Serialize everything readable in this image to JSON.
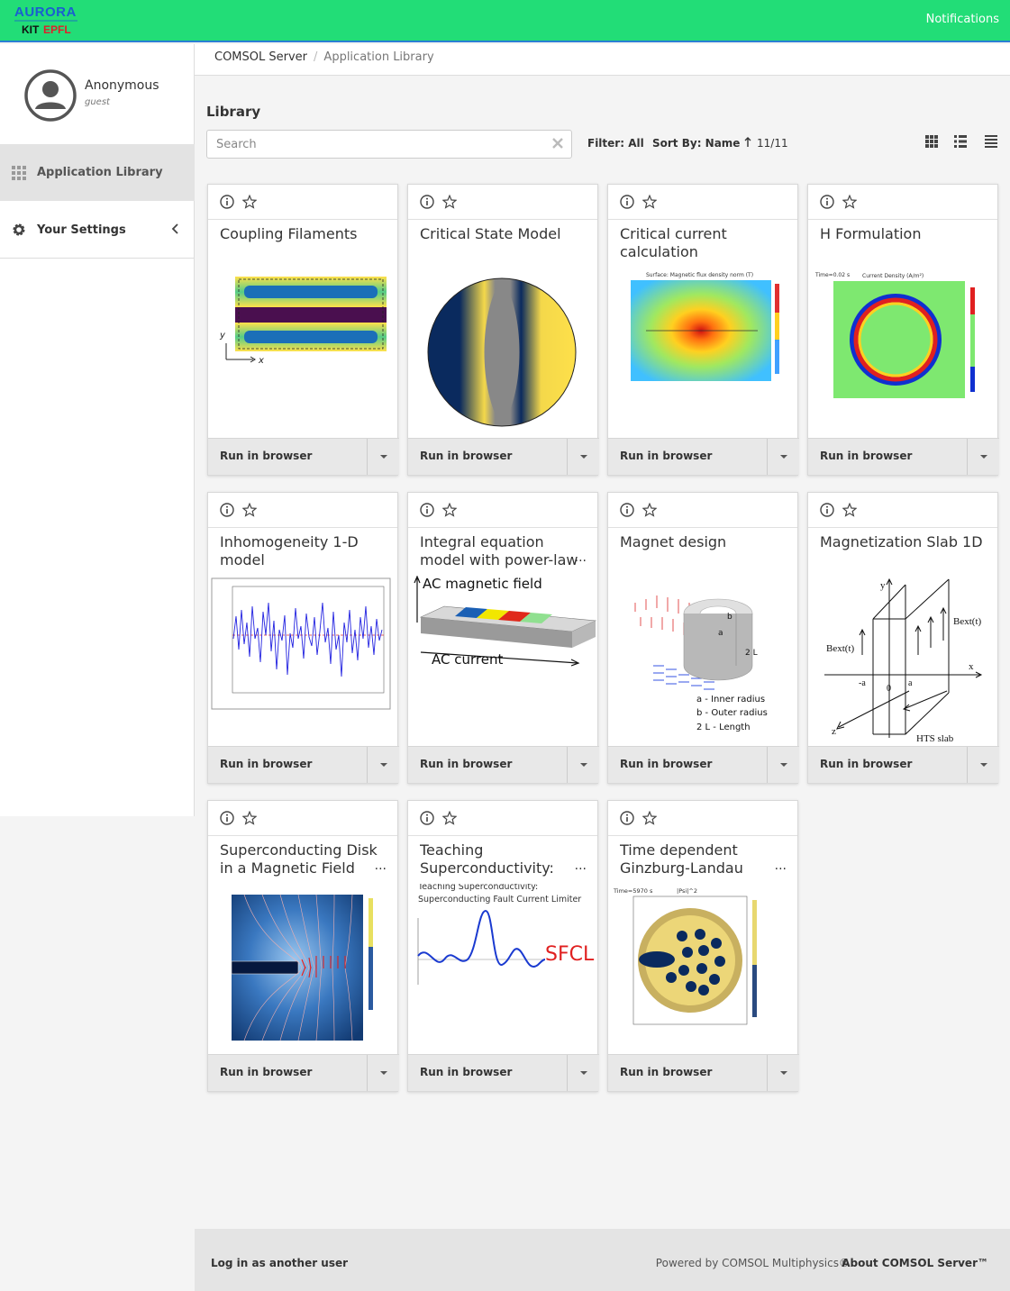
{
  "topbar": {
    "logo_top": "AURORA",
    "logo_kit": "KIT",
    "logo_epfl": "EPFL",
    "notifications": "Notifications"
  },
  "user": {
    "name": "Anonymous",
    "role": "guest"
  },
  "sidebar": {
    "items": [
      {
        "label": "Application Library",
        "icon": "grid-icon",
        "active": true
      },
      {
        "label": "Your Settings",
        "icon": "gear-icon",
        "active": false
      }
    ]
  },
  "breadcrumb": {
    "root": "COMSOL Server",
    "separator": "/",
    "current": "Application Library"
  },
  "library": {
    "title": "Library",
    "search_placeholder": "Search",
    "filter": "Filter: All",
    "sort": "Sort By: Name",
    "count": "11/11"
  },
  "cards": [
    {
      "title": "Coupling Filaments",
      "run": "Run in browser",
      "more": ""
    },
    {
      "title": "Critical State Model",
      "run": "Run in browser",
      "more": ""
    },
    {
      "title": "Critical current calculation",
      "run": "Run in browser",
      "more": ""
    },
    {
      "title": "H Formulation",
      "run": "Run in browser",
      "more": ""
    },
    {
      "title": "Inhomogeneity 1-D model",
      "run": "Run in browser",
      "more": ""
    },
    {
      "title": "Integral equation model with power-law",
      "run": "Run in browser",
      "more": "..."
    },
    {
      "title": "Magnet design",
      "run": "Run in browser",
      "more": ""
    },
    {
      "title": "Magnetization Slab 1D",
      "run": "Run in browser",
      "more": ""
    },
    {
      "title": "Superconducting Disk in a Magnetic Field",
      "run": "Run in browser",
      "more": "..."
    },
    {
      "title": "Teaching Superconductivity:",
      "run": "Run in browser",
      "more": "..."
    },
    {
      "title": "Time dependent Ginzburg-Landau",
      "run": "Run in browser",
      "more": "..."
    }
  ],
  "thumbs": {
    "coupling": {
      "y": "y",
      "x": "x"
    },
    "critcur": {
      "title": "Surface: Magnetic flux density norm (T)"
    },
    "hform": {
      "time": "Time=0.02 s",
      "title": "Current Density (A/m²)"
    },
    "integral": {
      "top": "AC magnetic field",
      "bottom": "AC current"
    },
    "magnet": {
      "l1": "a   - Inner radius",
      "l2": "b   - Outer radius",
      "l3": "2 L - Length",
      "a": "a",
      "b": "b",
      "len": "2 L"
    },
    "slab": {
      "y": "y",
      "x": "x",
      "z": "z",
      "bext_l": "Bext(t)",
      "bext_r": "Bext(t)",
      "hts": "HTS slab",
      "neg_a": "-a",
      "zero": "0",
      "pos_a": "a"
    },
    "teaching": {
      "l1": "Teaching Superconductivity:",
      "l2": "Superconducting Fault Current Limiter",
      "sfcl": "SFCL"
    },
    "gl": {
      "time": "Time=5970 s",
      "title": "|Psi|^2"
    }
  },
  "footer": {
    "login": "Log in as another user",
    "powered": "Powered by COMSOL Multiphysics®",
    "about": "About COMSOL Server™"
  },
  "colors": {
    "topbar": "#22dd77",
    "accent_line": "#2b7fd4"
  }
}
